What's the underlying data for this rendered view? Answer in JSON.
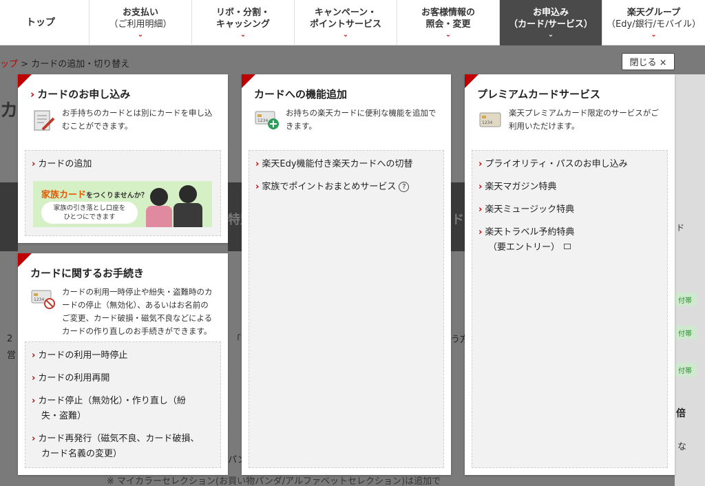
{
  "colors": {
    "accent": "#bf0000",
    "nav_active": "#4a4a4a",
    "panel_link_bg": "#f2f2f2"
  },
  "nav": {
    "top": "トップ",
    "items": [
      {
        "line1": "お支払い",
        "line2": "（ご利用明細）"
      },
      {
        "line1": "リボ・分割・",
        "line2": "キャッシング"
      },
      {
        "line1": "キャンペーン・",
        "line2": "ポイントサービス"
      },
      {
        "line1": "お客様情報の",
        "line2": "照会・変更"
      },
      {
        "line1": "お申込み",
        "line2": "（カード/サービス）"
      },
      {
        "line1": "楽天グループ",
        "line2": "（Edy/銀行/モバイル）"
      }
    ],
    "chevron": "⌄"
  },
  "breadcrumb": {
    "home": "ップ",
    "sep": " > ",
    "current": "カードの追加・切り替え"
  },
  "close_label": "閉じる ×",
  "panels": {
    "apply": {
      "title": "カードのお申し込み",
      "desc_line1": "お手持ちのカードとは別にカードを申し込",
      "desc_line2": "むことができます。",
      "links": [
        "カードの追加"
      ],
      "banner": {
        "headline": "家族カード",
        "headline_suffix": "をつくりませんか？",
        "pill_line1": "家族の引き落とし口座を",
        "pill_line2": "ひとつにできます"
      }
    },
    "function": {
      "title": "カードへの機能追加",
      "desc_line1": "お持ちの楽天カードに便利な機能を追加で",
      "desc_line2": "きます。",
      "links": [
        "楽天Edy機能付き楽天カードへの切替",
        "家族でポイントおまとめサービス"
      ],
      "help_icon": "?"
    },
    "premium": {
      "title": "プレミアムカードサービス",
      "desc_line1": "楽天プレミアムカード限定のサービスがご",
      "desc_line2": "利用いただけます。",
      "links": [
        "プライオリティ・パスのお申し込み",
        "楽天マガジン特典",
        "楽天ミュージック特典",
        "楽天トラベル予約特典",
        "（要エントリー）"
      ]
    },
    "procedures": {
      "title": "カードに関するお手続き",
      "desc_lines": [
        "カードの利用一時停止や紛失・盗難時のカ",
        "ードの停止（無効化）、あるいはお名前の",
        "ご変更、カード破損・磁気不良などによる",
        "カードの作り直しのお手続きができます。"
      ],
      "links": [
        "カードの利用一時停止",
        "カードの利用再開",
        "カード停止（無効化）・作り直し（紛",
        "失・盗難）",
        "カード再発行（磁気不良、カード破損、",
        "カード名義の変更）"
      ]
    }
  },
  "background": {
    "heading_char": "カ",
    "tag": "付帯",
    "overlay_text1": "特別",
    "overlay_text2": "ド",
    "bottom_note": "※ マイカラーセレクション(お買い物パンダ/アルファベットセレクション)は追加で",
    "right_text": "倍",
    "right_text2": "ド",
    "right_text3": "な",
    "mid_char": "パン",
    "left_num": "2",
    "left_char": "営",
    "mid_quote": "「",
    "right_char": "う方"
  }
}
